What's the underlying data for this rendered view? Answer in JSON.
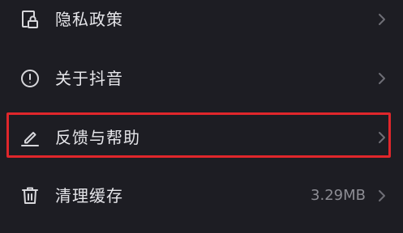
{
  "colors": {
    "background": "#1d1d23",
    "text": "#e6e6ea",
    "secondary_text": "#8c8c93",
    "icon": "#d8d8dc",
    "highlight": "#e0262b"
  },
  "menu": {
    "items": [
      {
        "label": "隐私政策",
        "icon": "privacy-document-lock-icon",
        "value": ""
      },
      {
        "label": "关于抖音",
        "icon": "info-circle-icon",
        "value": ""
      },
      {
        "label": "反馈与帮助",
        "icon": "pencil-icon",
        "value": ""
      },
      {
        "label": "清理缓存",
        "icon": "trash-icon",
        "value": "3.29MB"
      }
    ]
  }
}
